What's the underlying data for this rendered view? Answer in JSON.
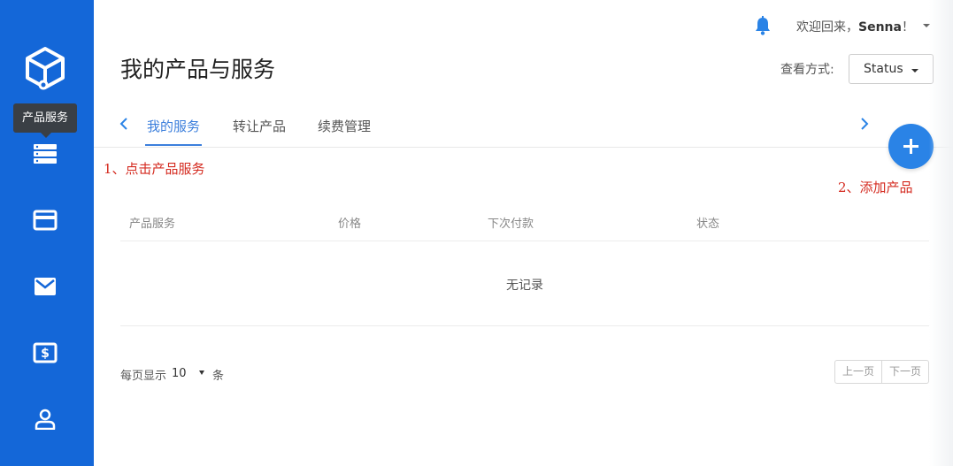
{
  "sidebar": {
    "logo_icon": "cube-logo-icon",
    "tooltip": "产品服务",
    "items": [
      {
        "icon": "server-list-icon",
        "label": "产品服务"
      },
      {
        "icon": "credit-card-icon"
      },
      {
        "icon": "mail-icon"
      },
      {
        "icon": "dollar-bill-icon"
      },
      {
        "icon": "user-icon"
      }
    ],
    "color": "#1467d8"
  },
  "header": {
    "welcome_prefix": "欢迎回来，",
    "username": "Senna",
    "welcome_suffix": "！",
    "bell_icon": "bell-icon"
  },
  "page": {
    "title": "我的产品与服务",
    "view_label": "查看方式:",
    "view_value": "Status"
  },
  "tabs": [
    {
      "label": "我的服务",
      "active": true
    },
    {
      "label": "转让产品",
      "active": false
    },
    {
      "label": "续费管理",
      "active": false
    }
  ],
  "annotations": {
    "step1": "1、点击产品服务",
    "step2": "2、添加产品",
    "color": "#d42a1f"
  },
  "table": {
    "columns": [
      "产品服务",
      "价格",
      "下次付款",
      "状态"
    ],
    "empty_text": "无记录"
  },
  "pagination": {
    "per_page_label": "每页显示",
    "per_page_value": "10",
    "per_page_unit": "条",
    "prev": "上一页",
    "next": "下一页"
  },
  "accent_color": "#3c7fdc"
}
